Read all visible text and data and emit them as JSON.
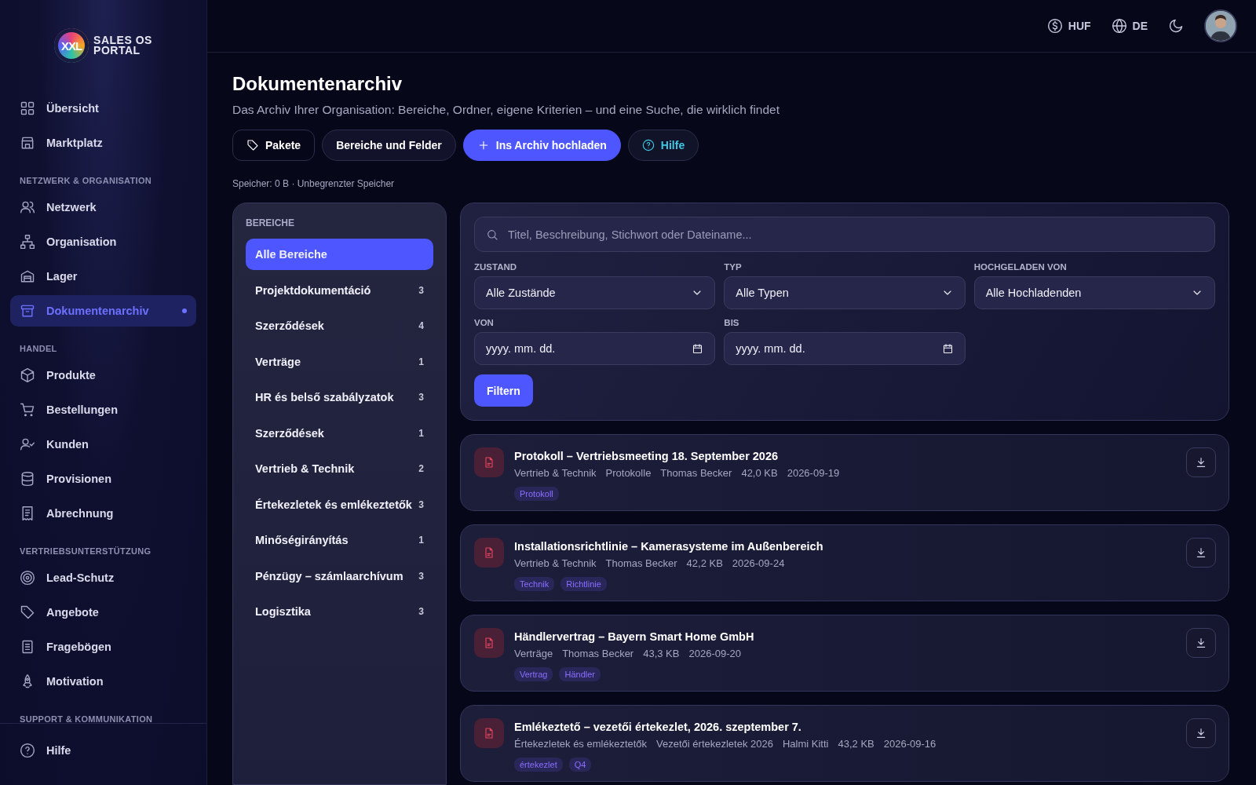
{
  "logo": {
    "mark": "XXL",
    "line1": "SALES OS",
    "line2": "PORTAL"
  },
  "sidebar": {
    "sections": [
      {
        "items": [
          {
            "label": "Übersicht",
            "selected": false
          },
          {
            "label": "Marktplatz",
            "selected": false
          }
        ]
      },
      {
        "heading": "NETZWERK & ORGANISATION",
        "items": [
          {
            "label": "Netzwerk",
            "selected": false
          },
          {
            "label": "Organisation",
            "selected": false
          },
          {
            "label": "Lager",
            "selected": false
          },
          {
            "label": "Dokumentenarchiv",
            "selected": true
          }
        ]
      },
      {
        "heading": "HANDEL",
        "items": [
          {
            "label": "Produkte",
            "selected": false
          },
          {
            "label": "Bestellungen",
            "selected": false
          },
          {
            "label": "Kunden",
            "selected": false
          },
          {
            "label": "Provisionen",
            "selected": false
          },
          {
            "label": "Abrechnung",
            "selected": false
          }
        ]
      },
      {
        "heading": "VERTRIEBSUNTERSTÜTZUNG",
        "items": [
          {
            "label": "Lead-Schutz",
            "selected": false
          },
          {
            "label": "Angebote",
            "selected": false
          },
          {
            "label": "Fragebögen",
            "selected": false
          },
          {
            "label": "Motivation",
            "selected": false
          }
        ]
      },
      {
        "heading": "SUPPORT & KOMMUNIKATION"
      }
    ],
    "footer": {
      "label": "Hilfe"
    }
  },
  "topbar": {
    "currency": "HUF",
    "language": "DE"
  },
  "page": {
    "title": "Dokumentenarchiv",
    "subtitle": "Das Archiv Ihrer Organisation: Bereiche, Ordner, eigene Kriterien – und eine Suche, die wirklich findet",
    "buttons": [
      {
        "label": "Pakete",
        "kind": "tag"
      },
      {
        "label": "Bereiche und Felder",
        "kind": "plain"
      },
      {
        "label": "Ins Archiv hochladen",
        "kind": "primary"
      },
      {
        "label": "Hilfe",
        "kind": "help"
      }
    ],
    "storage": "Speicher: 0 B · Unbegrenzter Speicher"
  },
  "areas": {
    "heading": "BEREICHE",
    "items": [
      {
        "label": "Alle Bereiche",
        "selected": true
      },
      {
        "label": "Projektdokumentáció",
        "count": "3",
        "selected": false
      },
      {
        "label": "Szerződések",
        "count": "4",
        "selected": false
      },
      {
        "label": "Verträge",
        "count": "1",
        "selected": false
      },
      {
        "label": "HR és belső szabályzatok",
        "count": "3",
        "selected": false
      },
      {
        "label": "Szerződések",
        "count": "1",
        "selected": false
      },
      {
        "label": "Vertrieb & Technik",
        "count": "2",
        "selected": false
      },
      {
        "label": "Értekezletek és emlékeztetők",
        "count": "3",
        "selected": false
      },
      {
        "label": "Minőségirányítás",
        "count": "1",
        "selected": false
      },
      {
        "label": "Pénzügy – számlaarchívum",
        "count": "3",
        "selected": false
      },
      {
        "label": "Logisztika",
        "count": "3",
        "selected": false
      }
    ]
  },
  "filters": {
    "search": {
      "placeholder": "Titel, Beschreibung, Stichwort oder Dateiname..."
    },
    "selects": [
      {
        "label": "ZUSTAND",
        "value": "Alle Zustände"
      },
      {
        "label": "TYP",
        "value": "Alle Typen"
      },
      {
        "label": "HOCHGELADEN VON",
        "value": "Alle Hochladenden"
      }
    ],
    "dates": [
      {
        "label": "VON",
        "placeholder": "yyyy. mm. dd."
      },
      {
        "label": "BIS",
        "placeholder": "yyyy. mm. dd."
      }
    ],
    "button": "Filtern"
  },
  "documents": [
    {
      "title": "Protokoll – Vertriebsmeeting 18. September 2026",
      "meta": [
        "Vertrieb & Technik",
        "Protokolle",
        "Thomas Becker",
        "42,0 KB",
        "2026-09-19"
      ],
      "tags": [
        "Protokoll"
      ]
    },
    {
      "title": "Installationsrichtlinie – Kamerasysteme im Außenbereich",
      "meta": [
        "Vertrieb & Technik",
        "Thomas Becker",
        "42,2 KB",
        "2026-09-24"
      ],
      "tags": [
        "Technik",
        "Richtlinie"
      ]
    },
    {
      "title": "Händlervertrag – Bayern Smart Home GmbH",
      "meta": [
        "Verträge",
        "Thomas Becker",
        "43,3 KB",
        "2026-09-20"
      ],
      "tags": [
        "Vertrag",
        "Händler"
      ]
    },
    {
      "title": "Emlékeztető – vezetői értekezlet, 2026. szeptember 7.",
      "meta": [
        "Értekezletek és emlékeztetők",
        "Vezetői értekezletek 2026",
        "Halmi Kitti",
        "43,2 KB",
        "2026-09-16"
      ],
      "tags": [
        "értekezlet",
        "Q4"
      ]
    }
  ]
}
